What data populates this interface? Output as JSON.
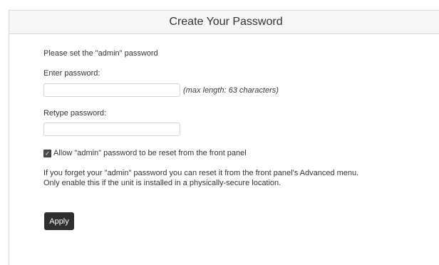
{
  "dialog": {
    "title": "Create Your Password"
  },
  "intro_text": "Please set the \"admin\" password",
  "password_field": {
    "label": "Enter password:",
    "value": "",
    "hint": "(max length: 63 characters)"
  },
  "retype_field": {
    "label": "Retype password:",
    "value": ""
  },
  "allow_reset": {
    "checked": true,
    "label": "Allow \"admin\" password to be reset from the front panel"
  },
  "info_text": {
    "line1": "If you forget your \"admin\" password you can reset it from the front panel's Advanced menu.",
    "line2": "Only enable this if the unit is installed in a physically-secure location."
  },
  "apply_button": {
    "label": "Apply"
  }
}
